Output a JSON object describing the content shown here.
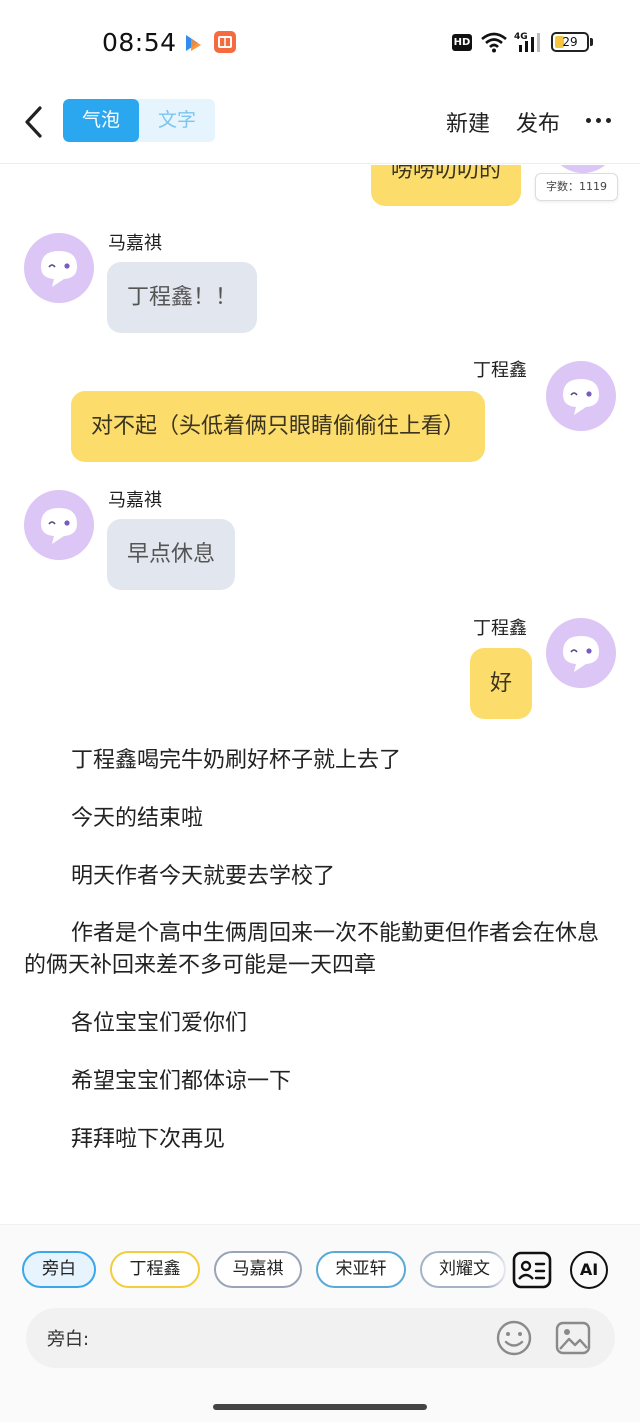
{
  "status_bar": {
    "time": "08:54",
    "hd": "HD",
    "battery": "29",
    "battery_level": 0.29
  },
  "header": {
    "back_icon": "chevron-left-icon",
    "mode_tabs": [
      "气泡",
      "文字"
    ],
    "active_mode": "气泡",
    "new_label": "新建",
    "publish_label": "发布",
    "more_icon": "more-dots-icon"
  },
  "chat": {
    "partial_top_bubble": "唠唠叨叨的",
    "word_count": "字数：1119",
    "messages": [
      {
        "speaker": "马嘉祺",
        "side": "left",
        "text": "丁程鑫！！"
      },
      {
        "speaker": "丁程鑫",
        "side": "right",
        "text": "对不起（头低着俩只眼睛偷偷往上看）"
      },
      {
        "speaker": "马嘉祺",
        "side": "left",
        "text": "早点休息"
      },
      {
        "speaker": "丁程鑫",
        "side": "right",
        "text": "好"
      }
    ],
    "narration": [
      "丁程鑫喝完牛奶刷好杯子就上去了",
      "今天的结束啦",
      "明天作者今天就要去学校了",
      "作者是个高中生俩周回来一次不能勤更但作者会在休息的俩天补回来差不多可能是一天四章",
      "各位宝宝们爱你们",
      "希望宝宝们都体谅一下",
      "拜拜啦下次再见"
    ]
  },
  "bottom": {
    "characters": [
      "旁白",
      "丁程鑫",
      "马嘉祺",
      "宋亚轩",
      "刘耀文"
    ],
    "selected_character": "旁白",
    "roster_icon": "character-list-icon",
    "ai_label": "AI",
    "input_label": "旁白:",
    "emoji_icon": "emoji-icon",
    "image_icon": "image-icon"
  },
  "colors": {
    "accent_blue": "#2aa7ef",
    "bubble_yellow": "#fcdd6c",
    "bubble_gray": "#e2e7ef",
    "avatar_purple": "#dcc6f6"
  }
}
